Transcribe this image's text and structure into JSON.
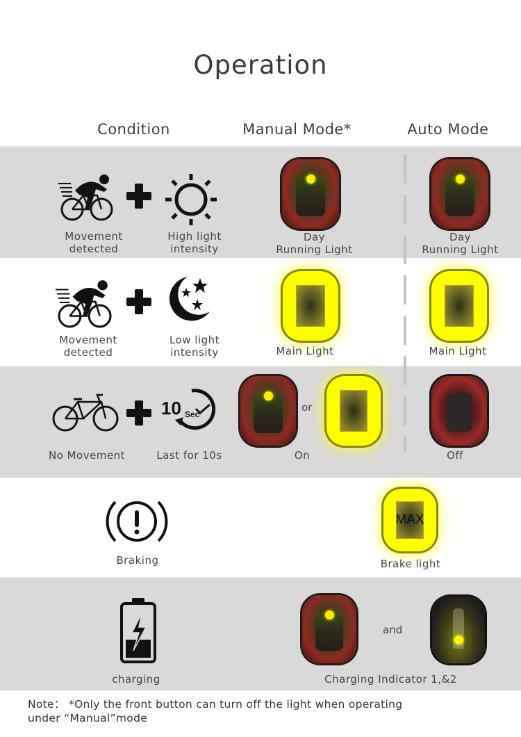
{
  "page": {
    "title": "Operation",
    "columns": {
      "condition": "Condition",
      "manual": "Manual Mode*",
      "auto": "Auto Mode"
    }
  },
  "rows": [
    {
      "conditions": [
        {
          "icon": "cyclist-icon",
          "label_line1": "Movement",
          "label_line2": "detected"
        },
        {
          "icon": "sun-icon",
          "label_line1": "High light",
          "label_line2": "intensity"
        }
      ],
      "manual": {
        "state": "day-running",
        "label_line1": "Day",
        "label_line2": "Running Light"
      },
      "auto": {
        "state": "day-running",
        "label_line1": "Day",
        "label_line2": "Running Light"
      }
    },
    {
      "conditions": [
        {
          "icon": "cyclist-icon",
          "label_line1": "Movement",
          "label_line2": "detected"
        },
        {
          "icon": "moon-stars-icon",
          "label_line1": "Low light",
          "label_line2": "intensity"
        }
      ],
      "manual": {
        "state": "main",
        "label": "Main Light"
      },
      "auto": {
        "state": "main",
        "label": "Main Light"
      }
    },
    {
      "conditions": [
        {
          "icon": "bicycle-icon",
          "label": "No Movement"
        },
        {
          "icon": "timer-10sec-icon",
          "label": "Last for 10s",
          "timer_number": "10",
          "timer_unit": "Sec"
        }
      ],
      "manual": {
        "state": "on",
        "label": "On",
        "conjunction": "or"
      },
      "auto": {
        "state": "off",
        "label": "Off"
      }
    },
    {
      "conditions": [
        {
          "icon": "brake-warning-icon",
          "label": "Braking"
        }
      ],
      "result": {
        "state": "brake",
        "label": "Brake light",
        "overlay_text": "MAX"
      }
    },
    {
      "conditions": [
        {
          "icon": "battery-charging-icon",
          "label": "charging"
        }
      ],
      "result": {
        "label": "Charging Indicator 1,&2",
        "conjunction": "and"
      }
    }
  ],
  "plus_symbol": "+",
  "note": {
    "line1": "Note： *Only the front button can turn off the light  when operating",
    "line2": "under “Manual”mode"
  },
  "colors": {
    "band_gray": "#d9d9d9",
    "light_yellow": "#ffff00",
    "light_red": "#9a2a28",
    "text": "#444444"
  }
}
